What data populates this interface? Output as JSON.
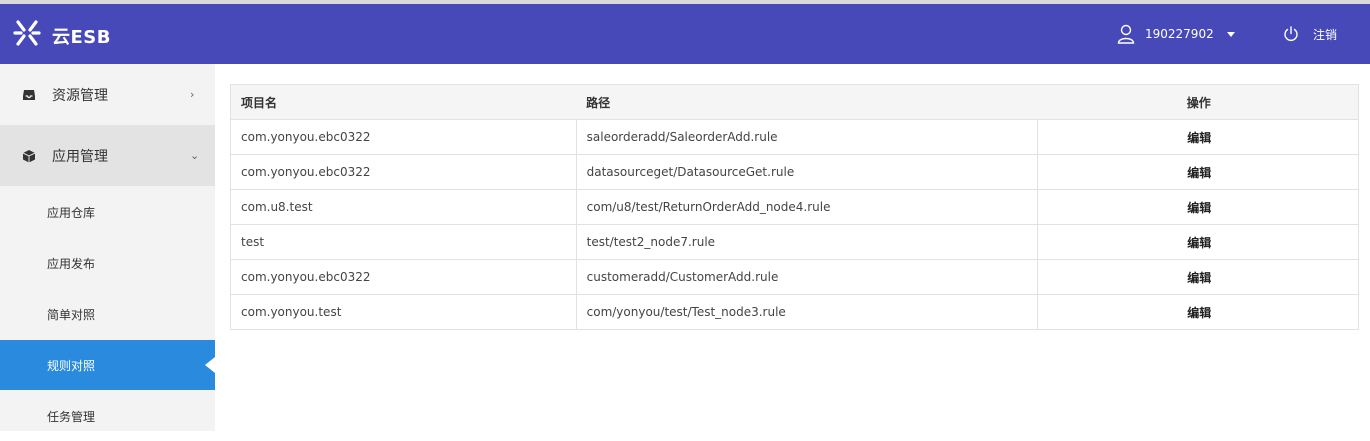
{
  "header": {
    "brand": "云ESB",
    "username": "190227902",
    "logout_label": "注销",
    "logo_icon": "esb-logo-icon",
    "user_icon": "user-icon",
    "power_icon": "power-icon",
    "background_color": "#4749b9"
  },
  "sidebar": {
    "menus": [
      {
        "label": "资源管理",
        "icon": "inbox-icon",
        "chevron": "›",
        "expanded": false
      },
      {
        "label": "应用管理",
        "icon": "cube-icon",
        "chevron": "⌄",
        "expanded": true
      }
    ],
    "sub_items": [
      {
        "label": "应用仓库"
      },
      {
        "label": "应用发布"
      },
      {
        "label": "简单对照"
      },
      {
        "label": "规则对照",
        "active": true
      },
      {
        "label": "任务管理"
      }
    ],
    "active_color": "#2a8bde"
  },
  "table": {
    "headers": [
      "项目名",
      "路径",
      "操作"
    ],
    "rows": [
      {
        "project": "com.yonyou.ebc0322",
        "path": "saleorderadd/SaleorderAdd.rule",
        "action": "编辑"
      },
      {
        "project": "com.yonyou.ebc0322",
        "path": "datasourceget/DatasourceGet.rule",
        "action": "编辑"
      },
      {
        "project": "com.u8.test",
        "path": "com/u8/test/ReturnOrderAdd_node4.rule",
        "action": "编辑"
      },
      {
        "project": "test",
        "path": "test/test2_node7.rule",
        "action": "编辑"
      },
      {
        "project": "com.yonyou.ebc0322",
        "path": "customeradd/CustomerAdd.rule",
        "action": "编辑"
      },
      {
        "project": "com.yonyou.test",
        "path": "com/yonyou/test/Test_node3.rule",
        "action": "编辑"
      }
    ]
  }
}
